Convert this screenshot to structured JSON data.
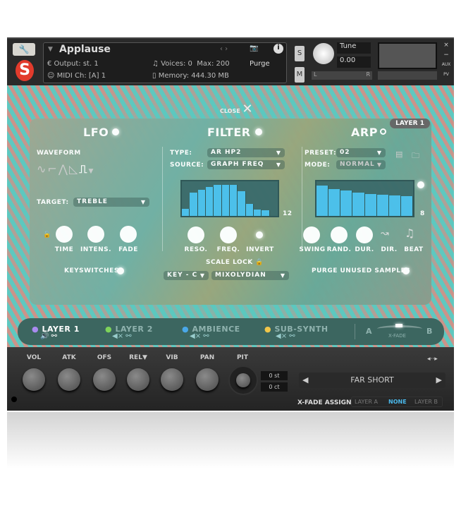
{
  "header": {
    "instrument": "Applause",
    "output_label": "Output:",
    "output": "st. 1",
    "midi_label": "MIDI Ch:",
    "midi": "[A] 1",
    "voices_label": "Voices:",
    "voices": "0",
    "max_label": "Max:",
    "max": "200",
    "memory_label": "Memory:",
    "memory": "444.30 MB",
    "purge": "Purge",
    "solo": "S",
    "mute": "M",
    "tune_label": "Tune",
    "tune": "0.00",
    "pan_l": "L",
    "pan_r": "R",
    "aux": "AUX",
    "pv": "PV",
    "close": "×",
    "minus": "−"
  },
  "close_label": "CLOSE",
  "panel": {
    "layer_badge": "LAYER 1",
    "lfo": {
      "title": "LFO",
      "on": true,
      "waveform_label": "WAVEFORM",
      "waveforms": [
        "sine",
        "square-step",
        "triangle",
        "saw",
        "random"
      ],
      "selected_waveform": "random",
      "target_label": "TARGET:",
      "target": "TREBLE",
      "knobs": [
        "TIME",
        "INTENS.",
        "FADE"
      ],
      "keyswitches": "KEYSWITCHES"
    },
    "filter": {
      "title": "FILTER",
      "on": true,
      "type_label": "TYPE:",
      "type": "AR HP2",
      "source_label": "SOURCE:",
      "source": "GRAPH FREQ",
      "steps": "12",
      "graph": [
        0.2,
        0.68,
        0.75,
        0.83,
        0.89,
        0.89,
        0.89,
        0.72,
        0.35,
        0.18,
        0.16,
        0
      ],
      "knobs": [
        "RESO.",
        "FREQ."
      ],
      "invert": "INVERT",
      "scale_lock": "SCALE LOCK",
      "key": "KEY - C",
      "scale": "MIXOLYDIAN"
    },
    "arp": {
      "title": "ARP",
      "on": false,
      "preset_label": "PRESET:",
      "preset": "02",
      "mode_label": "MODE:",
      "mode": "NORMAL",
      "steps": "8",
      "graph": [
        0.88,
        0.77,
        0.73,
        0.67,
        0.63,
        0.61,
        0.59,
        0.57
      ],
      "knobs": [
        "SWING",
        "RAND.",
        "DUR.",
        "DIR.",
        "BEAT"
      ],
      "purge": "PURGE UNUSED SAMPLES"
    }
  },
  "layers": [
    {
      "name": "LAYER 1",
      "color": "#a98bf0",
      "active": true
    },
    {
      "name": "LAYER 2",
      "color": "#7ed35a"
    },
    {
      "name": "AMBIENCE",
      "color": "#4aa8e8"
    },
    {
      "name": "SUB-SYNTH",
      "color": "#f0c64a"
    }
  ],
  "xfade": {
    "a": "A",
    "b": "B",
    "label": "X-FADE"
  },
  "bottom": {
    "knobs": [
      "VOL",
      "ATK",
      "OFS",
      "REL",
      "VIB",
      "PAN"
    ],
    "pit": "PIT",
    "st": "0 st",
    "ct": "0 ct",
    "preset": "FAR SHORT",
    "xfade_assign": "X-FADE ASSIGN",
    "assign_options": [
      "LAYER A",
      "NONE",
      "LAYER B"
    ],
    "assign_selected": "NONE"
  }
}
